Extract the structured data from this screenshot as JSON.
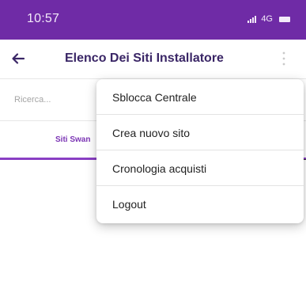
{
  "status_bar": {
    "time": "10:57",
    "network": "4G",
    "color": "#6f2ba6"
  },
  "header": {
    "title": "Elenco Dei Siti Installatore",
    "back_icon": "arrow-left-icon",
    "more_icon": "more-vertical-icon"
  },
  "search": {
    "placeholder": "Ricerca..."
  },
  "tabs": [
    {
      "label": "Siti Swan",
      "active": true
    }
  ],
  "menu": {
    "items": [
      {
        "label": "Sblocca Centrale"
      },
      {
        "label": "Crea nuovo sito"
      },
      {
        "label": "Cronologia acquisti"
      },
      {
        "label": "Logout"
      }
    ]
  },
  "colors": {
    "accent": "#8a3fc4",
    "title_text": "#3a2666"
  }
}
